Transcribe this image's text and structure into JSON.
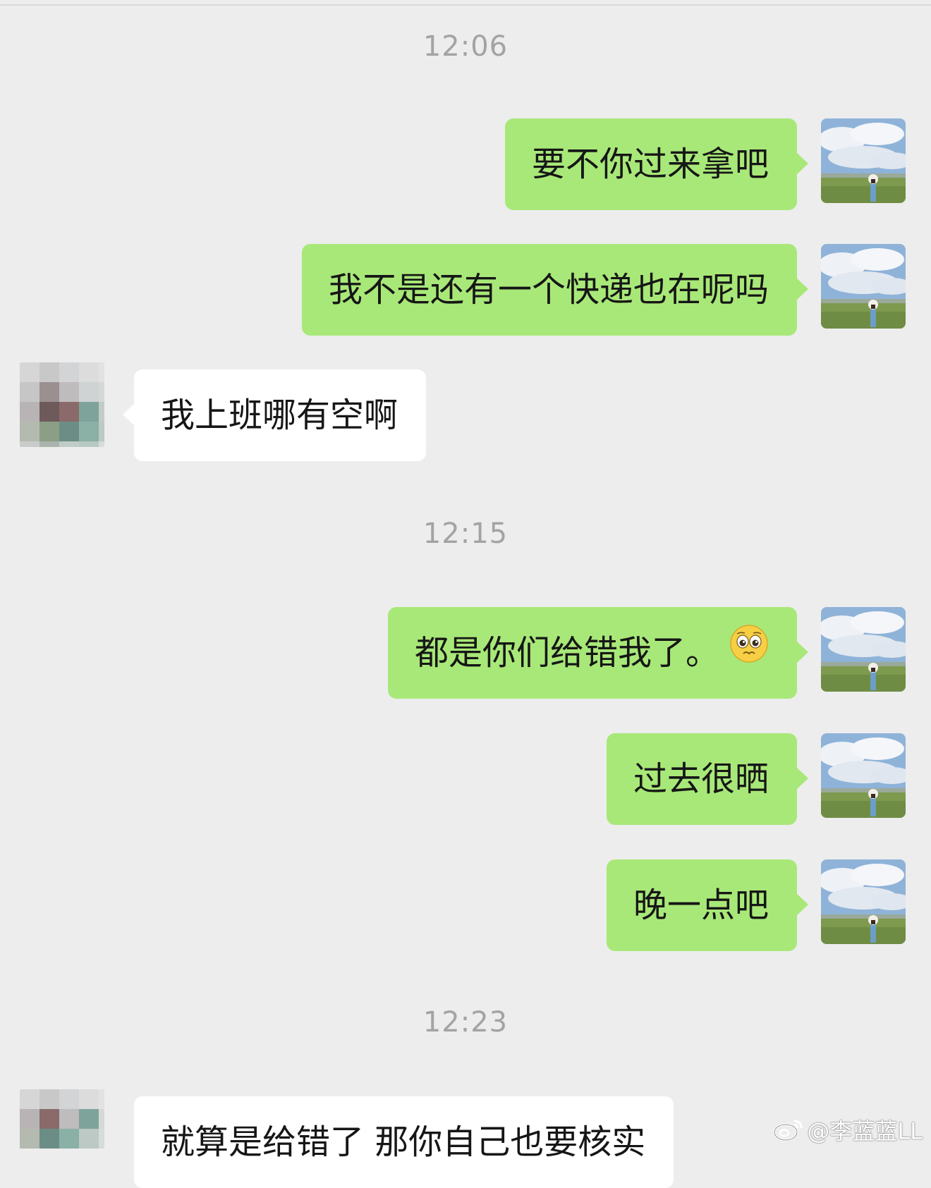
{
  "times": [
    "12:06",
    "12:15",
    "12:23"
  ],
  "messages": [
    {
      "side": "self",
      "text": "要不你过来拿吧"
    },
    {
      "side": "self",
      "text": "我不是还有一个快递也在呢吗"
    },
    {
      "side": "other",
      "text": "我上班哪有空啊"
    },
    {
      "side": "self",
      "text": "都是你们给错我了。",
      "emoji": "pleading-face-emoji"
    },
    {
      "side": "self",
      "text": "过去很晒"
    },
    {
      "side": "self",
      "text": "晚一点吧"
    },
    {
      "side": "other",
      "text": "就算是给错了 那你自己也要核实"
    }
  ],
  "avatars": {
    "self": "landscape-photo-avatar",
    "other": "pixelated-avatar"
  },
  "watermark": {
    "text": "@李蓝蓝LL",
    "icon": "weibo-logo-icon"
  },
  "colors": {
    "background": "#ededed",
    "self_bubble": "#a8e878",
    "other_bubble": "#ffffff",
    "time_text": "#a3a3a3"
  }
}
